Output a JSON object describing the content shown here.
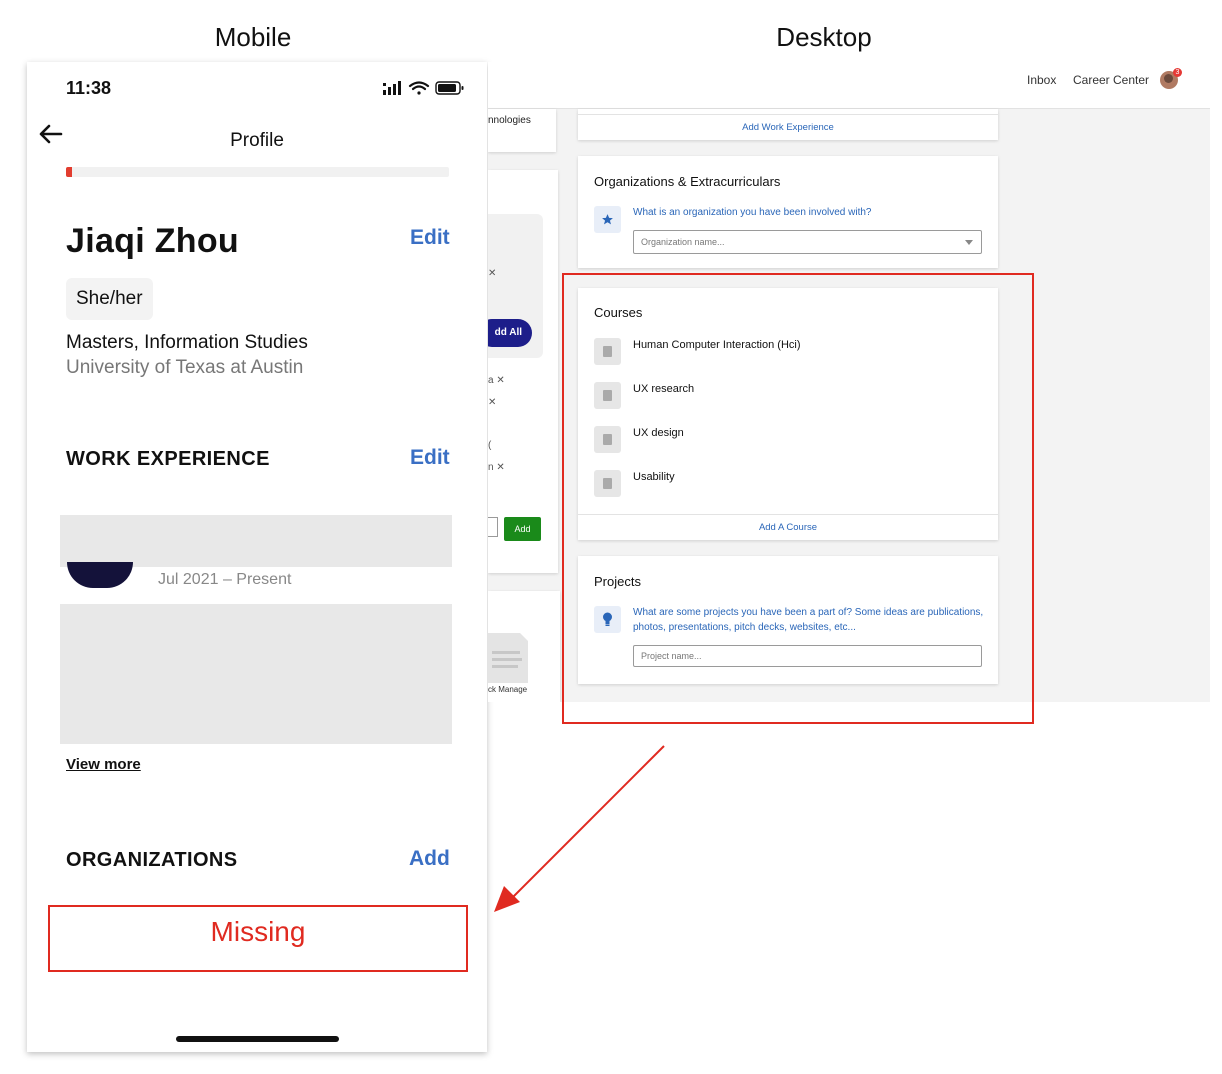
{
  "labels": {
    "mobile": "Mobile",
    "desktop": "Desktop"
  },
  "mobile": {
    "status_time": "11:38",
    "nav_title": "Profile",
    "progress_fraction": 0.015,
    "name": "Jiaqi Zhou",
    "edit_label": "Edit",
    "pronouns": "She/her",
    "degree": "Masters, Information Studies",
    "school": "University of Texas at Austin",
    "work_experience_heading": "WORK EXPERIENCE",
    "work_edit_label": "Edit",
    "job_date": "Jul 2021 – Present",
    "view_more": "View more",
    "organizations_heading": "ORGANIZATIONS",
    "organizations_add_label": "Add",
    "missing_label": "Missing"
  },
  "desktop": {
    "top_nav": {
      "inbox": "Inbox",
      "career_center": "Career Center",
      "notification_count": "3"
    },
    "partial_left": {
      "technologies_fragment": "nnologies",
      "add_all_fragment": "dd All",
      "add_button": "Add",
      "manage_fragment": "ck Manage"
    },
    "add_work_experience": "Add Work Experience",
    "organizations": {
      "title": "Organizations & Extracurriculars",
      "prompt": "What is an organization you have been involved with?",
      "placeholder": "Organization name..."
    },
    "courses": {
      "title": "Courses",
      "items": [
        "Human Computer Interaction (Hci)",
        "UX research",
        "UX design",
        "Usability"
      ],
      "add_label": "Add A Course"
    },
    "projects": {
      "title": "Projects",
      "prompt_line1": "What are some projects you have been a part of? Some ideas are publications,",
      "prompt_line2": "photos, presentations, pitch decks, websites, etc...",
      "placeholder": "Project name..."
    }
  },
  "colors": {
    "annotation_red": "#e02a20",
    "link_blue": "#2a66b8",
    "mobile_blue": "#3a6fc4",
    "add_green": "#1a8a1a"
  }
}
